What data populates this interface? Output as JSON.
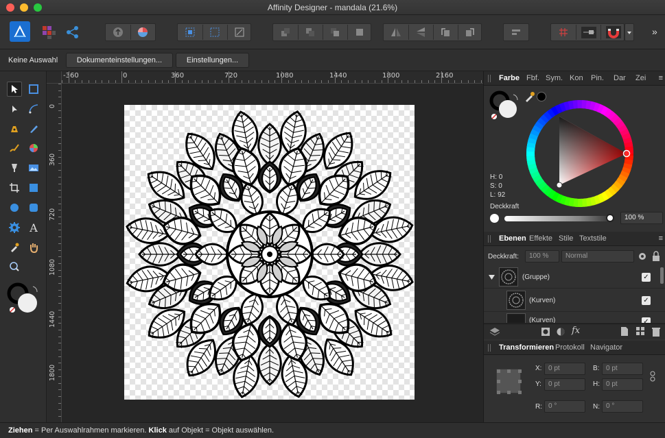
{
  "window": {
    "title": "Affinity Designer - mandala (21.6%)"
  },
  "context_bar": {
    "selection_label": "Keine Auswahl",
    "document_settings_button": "Dokumenteinstellungen...",
    "settings_button": "Einstellungen..."
  },
  "rulers": {
    "horizontal": [
      "-360",
      "0",
      "360",
      "720",
      "1080",
      "1440",
      "1800",
      "2160"
    ],
    "vertical": [
      "0",
      "360",
      "720",
      "1080",
      "1440",
      "1800"
    ]
  },
  "color_panel": {
    "tabs": [
      "Farbe",
      "Fbf.",
      "Sym.",
      "Kon",
      "Pin.",
      "Dar",
      "Zei"
    ],
    "h": "H: 0",
    "s": "S: 0",
    "l": "L: 92",
    "opacity_label": "Deckkraft",
    "opacity_value": "100 %"
  },
  "layers_panel": {
    "tabs": [
      "Ebenen",
      "Effekte",
      "Stile",
      "Textstile"
    ],
    "opacity_label": "Deckkraft:",
    "opacity_value": "100 %",
    "blend_mode": "Normal",
    "layers": [
      {
        "name": "(Gruppe)"
      },
      {
        "name": "(Kurven)"
      },
      {
        "name": "(Kurven)"
      }
    ]
  },
  "transform_panel": {
    "tabs": [
      "Transformieren",
      "Protokoll",
      "Navigator"
    ],
    "x_label": "X:",
    "x_value": "0 pt",
    "y_label": "Y:",
    "y_value": "0 pt",
    "b_label": "B:",
    "b_value": "0 pt",
    "h_label": "H:",
    "h_value": "0 pt",
    "r_label": "R:",
    "r_value": "0 °",
    "n_label": "N:",
    "n_value": "0 °"
  },
  "status": {
    "drag_key": "Ziehen",
    "drag_text": " = Per Auswahlrahmen markieren. ",
    "click_key": "Klick",
    "click_text": " auf Objekt = Objekt auswählen."
  },
  "colors": {
    "accent": "#ff3b3b",
    "panel_bg": "#313131",
    "canvas_bg": "#262626"
  }
}
